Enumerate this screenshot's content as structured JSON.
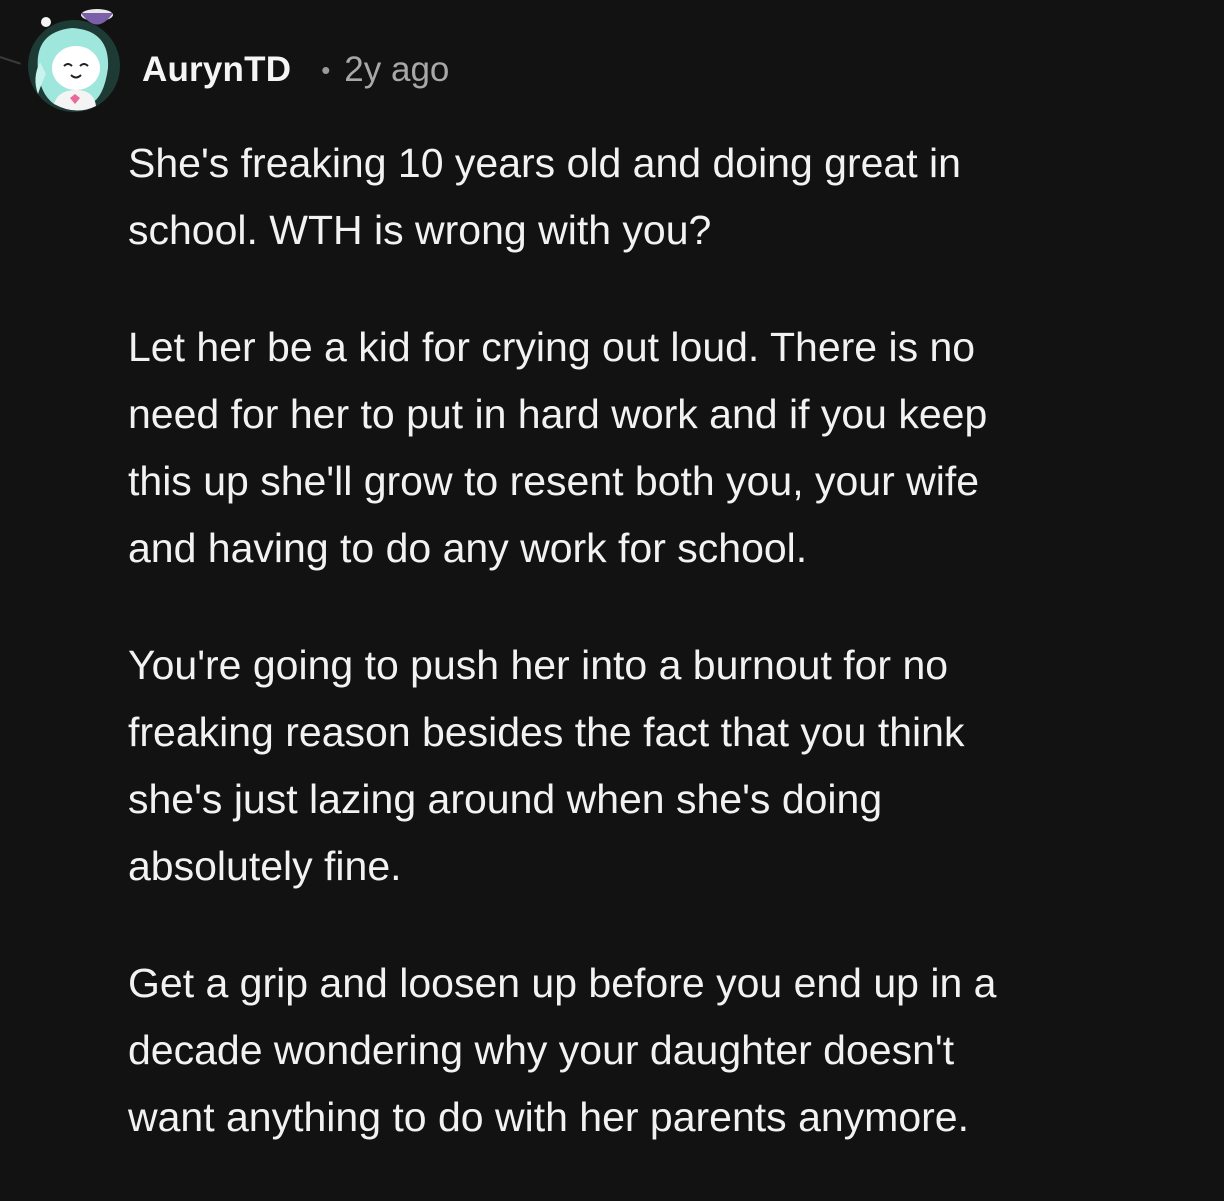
{
  "comment": {
    "username": "AurynTD",
    "separator": "•",
    "timestamp": "2y ago",
    "avatar_icon": "avatar-icon",
    "paragraphs": [
      [
        "She's freaking 10 years old and doing great in",
        "school. WTH is wrong with you?"
      ],
      [
        "Let her be a kid for crying out loud. There is no",
        "need for her to put in hard work and if you keep",
        "this up she'll grow to resent both you, your wife",
        "and having to do any work for school."
      ],
      [
        "You're going to push her into a burnout for no",
        "freaking reason besides the fact that you think",
        "she's just lazing around when she's doing",
        "absolutely fine."
      ],
      [
        "Get a grip and loosen up before you end up in a",
        "decade wondering why your daughter doesn't",
        "want anything to do with her parents anymore."
      ]
    ]
  },
  "colors": {
    "background": "#121212",
    "text": "#f2f2f2",
    "muted": "#a8a8a8"
  }
}
